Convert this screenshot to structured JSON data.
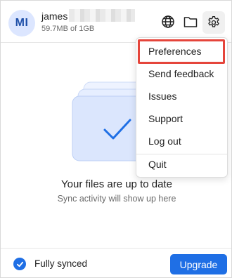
{
  "account": {
    "avatar_initials": "MI",
    "username": "james",
    "quota": "59.7MB of 1GB"
  },
  "header_icons": {
    "globe": "globe-icon",
    "folder": "folder-icon",
    "settings": "gear-icon"
  },
  "status": {
    "title": "Your files are up to date",
    "subtitle": "Sync activity will show up here"
  },
  "footer": {
    "sync_label": "Fully synced",
    "upgrade_label": "Upgrade"
  },
  "menu": {
    "items": [
      {
        "label": "Preferences"
      },
      {
        "label": "Send feedback"
      },
      {
        "label": "Issues"
      },
      {
        "label": "Support"
      },
      {
        "label": "Log out"
      },
      {
        "label": "Quit"
      }
    ]
  },
  "colors": {
    "accent": "#1f6fe5",
    "highlight": "#e5453b",
    "avatar_bg": "#dce6ff"
  }
}
